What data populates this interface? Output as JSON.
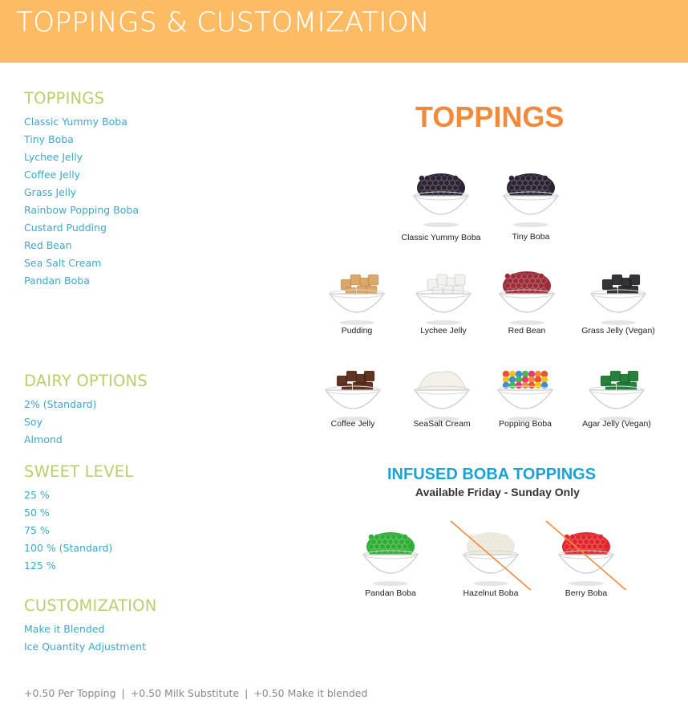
{
  "header": {
    "title": "TOPPINGS & CUSTOMIZATION"
  },
  "colors": {
    "header_bg": "#fdbb63",
    "section_heading": "#b7cf6d",
    "list_link": "#3aa9c9",
    "footer_text": "#888888",
    "menu_title_orange": "#f08a3c",
    "infused_blue": "#1aa2d8"
  },
  "sections": [
    {
      "heading": "TOPPINGS",
      "items": [
        "Classic Yummy Boba",
        "Tiny Boba",
        "Lychee Jelly",
        "Coffee Jelly",
        "Grass Jelly",
        "Rainbow Popping Boba",
        "Custard Pudding",
        "Red Bean",
        "Sea Salt Cream",
        "Pandan Boba"
      ]
    },
    {
      "heading": "DAIRY OPTIONS",
      "items": [
        "2% (Standard)",
        "Soy",
        "Almond"
      ]
    },
    {
      "heading": "SWEET LEVEL",
      "items": [
        "25 %",
        "50 %",
        "75 %",
        "100 % (Standard)",
        "125 %"
      ]
    },
    {
      "heading": "CUSTOMIZATION",
      "items": [
        "Make it Blended",
        "Ice Quantity Adjustment"
      ]
    }
  ],
  "footer": {
    "parts": [
      "+0.50 Per Topping",
      "+0.50 Milk Substitute",
      "+0.50 Make it blended"
    ],
    "separator": "|"
  },
  "menu_image": {
    "title": "TOPPINGS",
    "toppings": [
      {
        "label": "Classic Yummy Boba",
        "icon": "dark-boba-bowl-icon",
        "color": "#2b2232"
      },
      {
        "label": "Tiny Boba",
        "icon": "dark-boba-bowl-icon",
        "color": "#2b2232"
      },
      {
        "label": "Pudding",
        "icon": "pudding-bowl-icon",
        "color": "#dba463"
      },
      {
        "label": "Lychee Jelly",
        "icon": "lychee-jelly-bowl-icon",
        "color": "#f2f2ee"
      },
      {
        "label": "Red Bean",
        "icon": "red-bean-bowl-icon",
        "color": "#9b2b36"
      },
      {
        "label": "Grass Jelly (Vegan)",
        "icon": "grass-jelly-bowl-icon",
        "color": "#2a2a2e"
      },
      {
        "label": "Coffee Jelly",
        "icon": "coffee-jelly-bowl-icon",
        "color": "#5a2a18"
      },
      {
        "label": "SeaSalt Cream",
        "icon": "cream-bowl-icon",
        "color": "#f4f1ea"
      },
      {
        "label": "Popping Boba",
        "icon": "popping-boba-bowl-icon",
        "color": "#e8542e"
      },
      {
        "label": "Agar Jelly (Vegan)",
        "icon": "agar-jelly-bowl-icon",
        "color": "#1e7a33"
      }
    ],
    "infused": {
      "title": "INFUSED BOBA TOPPINGS",
      "subtitle": "Available Friday - Sunday Only",
      "items": [
        {
          "label": "Pandan Boba",
          "icon": "pandan-boba-bowl-icon",
          "color": "#2fae35",
          "unavailable": false
        },
        {
          "label": "Hazelnut Boba",
          "icon": "hazelnut-boba-bowl-icon",
          "color": "#ece8dc",
          "unavailable": true
        },
        {
          "label": "Berry Boba",
          "icon": "berry-boba-bowl-icon",
          "color": "#e0262c",
          "unavailable": true
        }
      ]
    }
  }
}
